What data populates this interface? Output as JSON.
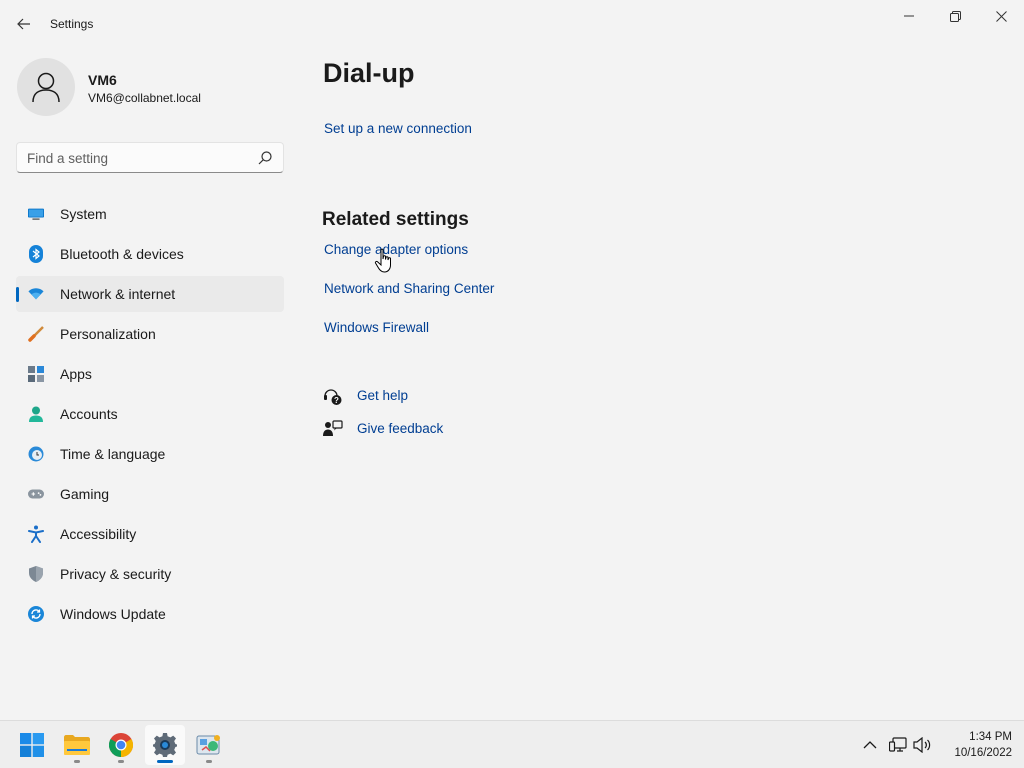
{
  "window": {
    "title": "Settings"
  },
  "profile": {
    "name": "VM6",
    "email": "VM6@collabnet.local"
  },
  "search": {
    "placeholder": "Find a setting",
    "value": ""
  },
  "nav": {
    "items": [
      {
        "label": "System",
        "icon": "monitor-icon",
        "active": false
      },
      {
        "label": "Bluetooth & devices",
        "icon": "bluetooth-icon",
        "active": false
      },
      {
        "label": "Network & internet",
        "icon": "wifi-icon",
        "active": true
      },
      {
        "label": "Personalization",
        "icon": "brush-icon",
        "active": false
      },
      {
        "label": "Apps",
        "icon": "apps-icon",
        "active": false
      },
      {
        "label": "Accounts",
        "icon": "person-icon",
        "active": false
      },
      {
        "label": "Time & language",
        "icon": "globe-clock-icon",
        "active": false
      },
      {
        "label": "Gaming",
        "icon": "gamepad-icon",
        "active": false
      },
      {
        "label": "Accessibility",
        "icon": "accessibility-icon",
        "active": false
      },
      {
        "label": "Privacy & security",
        "icon": "shield-icon",
        "active": false
      },
      {
        "label": "Windows Update",
        "icon": "update-icon",
        "active": false
      }
    ]
  },
  "main": {
    "title": "Dial-up",
    "setup_link": "Set up a new connection",
    "related_title": "Related settings",
    "related_links": [
      "Change adapter options",
      "Network and Sharing Center",
      "Windows Firewall"
    ],
    "help": {
      "get_help": "Get help",
      "give_feedback": "Give feedback"
    }
  },
  "taskbar": {
    "apps": [
      "start-icon",
      "file-explorer-icon",
      "chrome-icon",
      "settings-icon",
      "control-panel-icon"
    ],
    "clock": {
      "time": "1:34 PM",
      "date": "10/16/2022"
    }
  },
  "colors": {
    "accent": "#0067c0",
    "link": "#003e92",
    "background": "#f3f3f3"
  }
}
